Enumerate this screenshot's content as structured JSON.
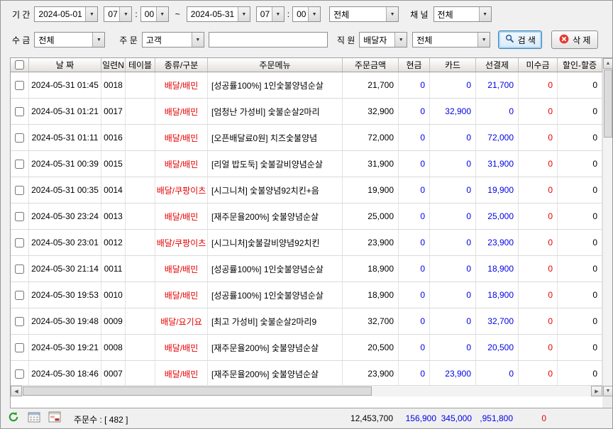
{
  "colors": {
    "negative_red": "#e60000",
    "payment_blue": "#0000e6",
    "type_red": "#e60000"
  },
  "icons": {
    "search": "magnifier-icon",
    "delete": "circle-x-icon",
    "refresh": "refresh-arrows-icon",
    "calendar": "calendar-icon",
    "export": "table-export-icon",
    "combo_arrow": "chevron-down-icon"
  },
  "filter": {
    "period_label": "기 간",
    "date_from": "2024-05-01",
    "hour_from": "07",
    "minute_from": "00",
    "time_separator": ":",
    "range_separator": "~",
    "date_to": "2024-05-31",
    "hour_to": "07",
    "minute_to": "00",
    "status_filter": "전체",
    "channel_label": "채 널",
    "channel_value": "전체",
    "collect_label": "수 금",
    "collect_value": "전체",
    "order_label": "주 문",
    "order_target": "고객",
    "keyword_value": "",
    "staff_label": "직 원",
    "staff_type": "배달자",
    "staff_value": "전체",
    "search_button": "검 색",
    "delete_button": "삭 제"
  },
  "table": {
    "headers": [
      "날 짜",
      "일련N",
      "테이블",
      "종류/구분",
      "주문메뉴",
      "주문금액",
      "현금",
      "카드",
      "선결제",
      "미수금",
      "할인-할증"
    ],
    "rows": [
      {
        "date": "2024-05-31 01:45",
        "no": "0018",
        "table": "",
        "type": "배달/배민",
        "menu": "[성공률100%] 1인숯불양념순살",
        "amount": "21,700",
        "cash": "0",
        "card": "0",
        "prepaid": "21,700",
        "unpaid": "0",
        "discount": "0"
      },
      {
        "date": "2024-05-31 01:21",
        "no": "0017",
        "table": "",
        "type": "배달/배민",
        "menu": "[엄청난 가성비] 숯불순살2마리",
        "amount": "32,900",
        "cash": "0",
        "card": "32,900",
        "prepaid": "0",
        "unpaid": "0",
        "discount": "0"
      },
      {
        "date": "2024-05-31 01:11",
        "no": "0016",
        "table": "",
        "type": "배달/배민",
        "menu": "[오픈배달료0원] 치즈숯불양념",
        "amount": "72,000",
        "cash": "0",
        "card": "0",
        "prepaid": "72,000",
        "unpaid": "0",
        "discount": "0"
      },
      {
        "date": "2024-05-31 00:39",
        "no": "0015",
        "table": "",
        "type": "배달/배민",
        "menu": "[리얼 밥도둑] 숯불갈비양념순살",
        "amount": "31,900",
        "cash": "0",
        "card": "0",
        "prepaid": "31,900",
        "unpaid": "0",
        "discount": "0"
      },
      {
        "date": "2024-05-31 00:35",
        "no": "0014",
        "table": "",
        "type": "배달/쿠팡이츠",
        "menu": "[시그니처] 숯불양념92치킨+음",
        "amount": "19,900",
        "cash": "0",
        "card": "0",
        "prepaid": "19,900",
        "unpaid": "0",
        "discount": "0"
      },
      {
        "date": "2024-05-30 23:24",
        "no": "0013",
        "table": "",
        "type": "배달/배민",
        "menu": "[재주문율200%] 숯불양념순살",
        "amount": "25,000",
        "cash": "0",
        "card": "0",
        "prepaid": "25,000",
        "unpaid": "0",
        "discount": "0"
      },
      {
        "date": "2024-05-30 23:01",
        "no": "0012",
        "table": "",
        "type": "배달/쿠팡이츠",
        "menu": "[시그니처]숯불갈비양념92치킨",
        "amount": "23,900",
        "cash": "0",
        "card": "0",
        "prepaid": "23,900",
        "unpaid": "0",
        "discount": "0"
      },
      {
        "date": "2024-05-30 21:14",
        "no": "0011",
        "table": "",
        "type": "배달/배민",
        "menu": "[성공률100%] 1인숯불양념순살",
        "amount": "18,900",
        "cash": "0",
        "card": "0",
        "prepaid": "18,900",
        "unpaid": "0",
        "discount": "0"
      },
      {
        "date": "2024-05-30 19:53",
        "no": "0010",
        "table": "",
        "type": "배달/배민",
        "menu": "[성공률100%] 1인숯불양념순살",
        "amount": "18,900",
        "cash": "0",
        "card": "0",
        "prepaid": "18,900",
        "unpaid": "0",
        "discount": "0"
      },
      {
        "date": "2024-05-30 19:48",
        "no": "0009",
        "table": "",
        "type": "배달/요기요",
        "menu": "[최고 가성비] 숯불순살2마리9",
        "amount": "32,700",
        "cash": "0",
        "card": "0",
        "prepaid": "32,700",
        "unpaid": "0",
        "discount": "0"
      },
      {
        "date": "2024-05-30 19:21",
        "no": "0008",
        "table": "",
        "type": "배달/배민",
        "menu": "[재주문율200%] 숯불양념순살",
        "amount": "20,500",
        "cash": "0",
        "card": "0",
        "prepaid": "20,500",
        "unpaid": "0",
        "discount": "0"
      },
      {
        "date": "2024-05-30 18:46",
        "no": "0007",
        "table": "",
        "type": "배달/배민",
        "menu": "[재주문율200%] 숯불양념순살",
        "amount": "23,900",
        "cash": "0",
        "card": "23,900",
        "prepaid": "0",
        "unpaid": "0",
        "discount": "0"
      }
    ]
  },
  "statusbar": {
    "order_count_label": "주문수 : [ 482 ]",
    "sum_amount": "12,453,700",
    "sum_cash": "156,900",
    "sum_card": "345,000",
    "sum_prepaid": ",951,800",
    "sum_unpaid": "0"
  }
}
